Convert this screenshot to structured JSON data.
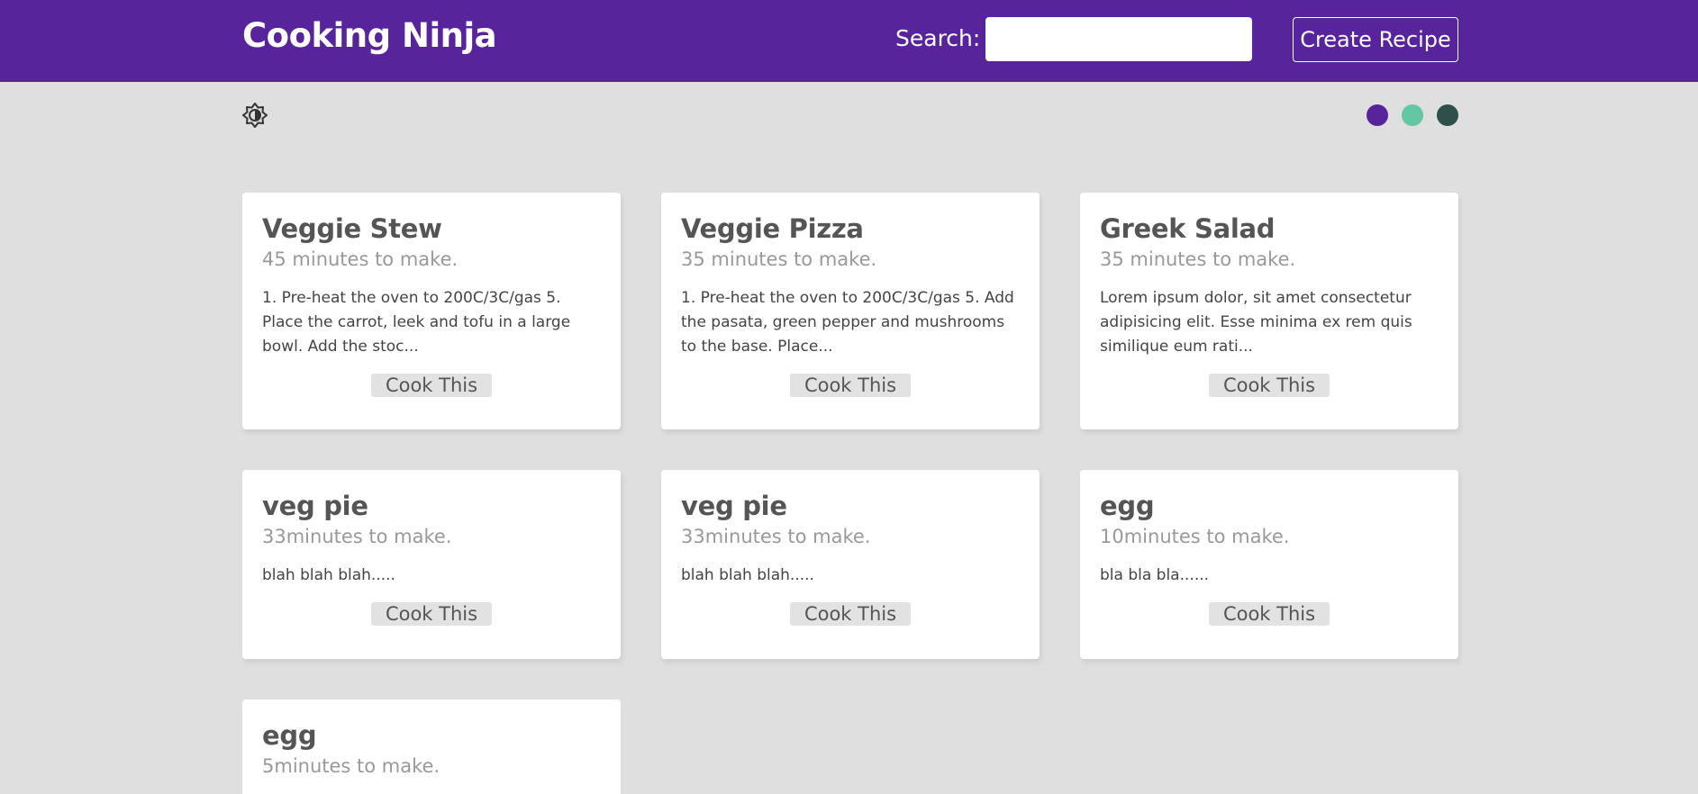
{
  "app": {
    "title": "Cooking Ninja"
  },
  "search": {
    "label": "Search:",
    "value": "",
    "placeholder": ""
  },
  "nav": {
    "create_label": "Create Recipe"
  },
  "theme": {
    "toggle_icon": "brightness-icon",
    "swatches": [
      {
        "name": "purple",
        "color": "#58249c"
      },
      {
        "name": "teal",
        "color": "#64c7a4"
      },
      {
        "name": "dark-green",
        "color": "#2e4f4a"
      }
    ]
  },
  "colors": {
    "navbar": "#58249c",
    "background": "#dfdfdf"
  },
  "recipes": [
    {
      "title": "Veggie Stew",
      "time": "45 minutes to make.",
      "description": "1. Pre-heat the oven to 200C/3C/gas 5. Place the carrot, leek and tofu in a large bowl. Add the stoc...",
      "action": "Cook This"
    },
    {
      "title": "Veggie Pizza",
      "time": "35 minutes to make.",
      "description": "1. Pre-heat the oven to 200C/3C/gas 5. Add the pasata, green pepper and mushrooms to the base. Place...",
      "action": "Cook This"
    },
    {
      "title": "Greek Salad",
      "time": "35 minutes to make.",
      "description": "Lorem ipsum dolor, sit amet consectetur adipisicing elit. Esse minima ex rem quis similique eum rati...",
      "action": "Cook This"
    },
    {
      "title": "veg pie",
      "time": "33minutes to make.",
      "description": "blah blah blah.....",
      "action": "Cook This"
    },
    {
      "title": "veg pie",
      "time": "33minutes to make.",
      "description": "blah blah blah.....",
      "action": "Cook This"
    },
    {
      "title": "egg",
      "time": "10minutes to make.",
      "description": "bla bla bla......",
      "action": "Cook This"
    },
    {
      "title": "egg",
      "time": "5minutes to make.",
      "description": "",
      "action": ""
    }
  ]
}
